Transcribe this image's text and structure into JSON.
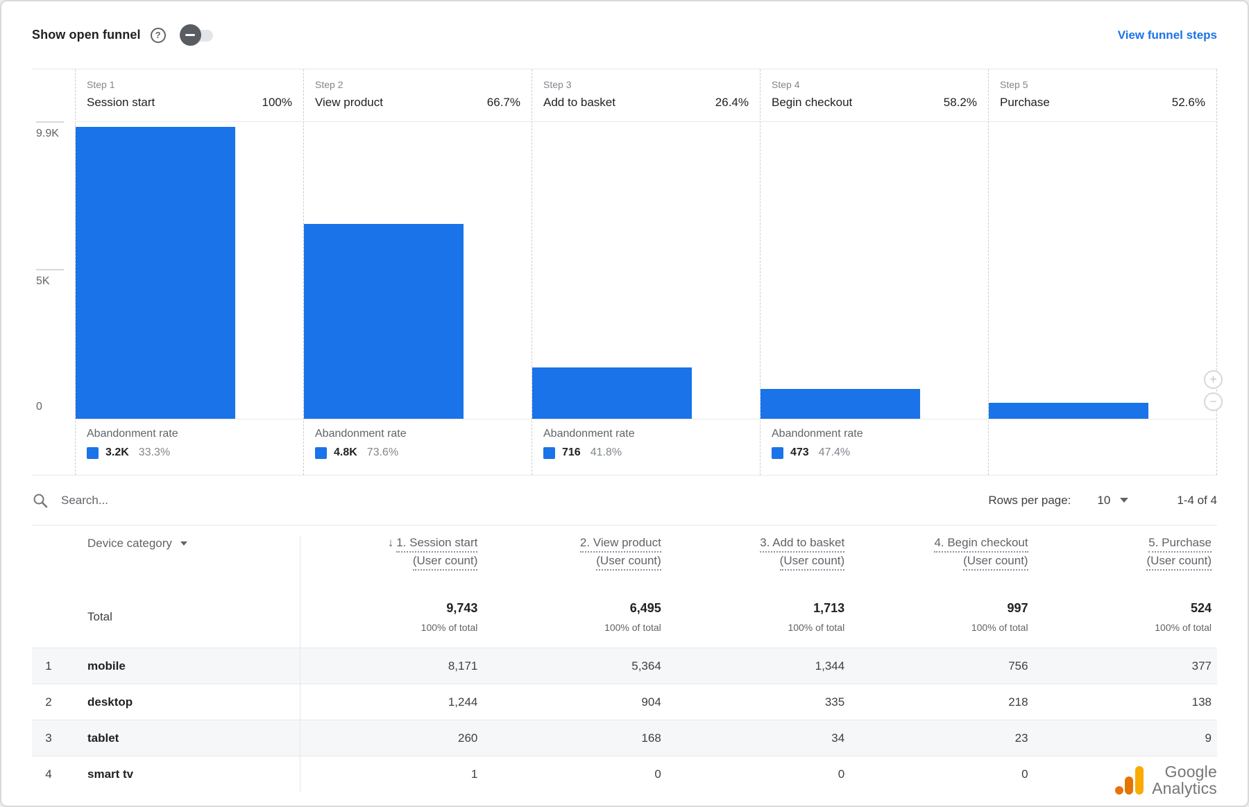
{
  "header": {
    "toggle_label": "Show open funnel",
    "link_label": "View funnel steps"
  },
  "icons": {
    "help": "circled-question-mark",
    "toggle_state": "indeterminate-off",
    "search": "magnifier",
    "rows_caret": "triangle-down",
    "device_caret": "triangle-down",
    "sort": "down-arrow",
    "zoom_in": "plus-circle",
    "zoom_out": "minus-circle"
  },
  "colors": {
    "accent_blue": "#1a73e8",
    "logo_amber": "#f9ab00",
    "logo_orange": "#e37400",
    "logo_deep_orange": "#e8710a"
  },
  "chart_data": {
    "type": "bar",
    "title": "Funnel steps (user count per step)",
    "ylim": [
      0,
      9900
    ],
    "y_axis_ticks": [
      "9.9K",
      "5K",
      "0"
    ],
    "grid": "horizontal ticks only",
    "bar_color": "#1a73e8",
    "abandonment_label": "Abandonment rate",
    "steps": [
      {
        "step_label": "Step 1",
        "name": "Session start",
        "percent": "100%",
        "value": 9743,
        "abandonment": {
          "count": "3.2K",
          "rate": "33.3%"
        }
      },
      {
        "step_label": "Step 2",
        "name": "View product",
        "percent": "66.7%",
        "value": 6495,
        "abandonment": {
          "count": "4.8K",
          "rate": "73.6%"
        }
      },
      {
        "step_label": "Step 3",
        "name": "Add to basket",
        "percent": "26.4%",
        "value": 1713,
        "abandonment": {
          "count": "716",
          "rate": "41.8%"
        }
      },
      {
        "step_label": "Step 4",
        "name": "Begin checkout",
        "percent": "58.2%",
        "value": 997,
        "abandonment": {
          "count": "473",
          "rate": "47.4%"
        }
      },
      {
        "step_label": "Step 5",
        "name": "Purchase",
        "percent": "52.6%",
        "value": 524,
        "abandonment": null
      }
    ]
  },
  "toolbar": {
    "search_placeholder": "Search...",
    "rows_per_page_label": "Rows per page:",
    "rows_per_page_value": "10",
    "range_label": "1-4 of 4"
  },
  "table": {
    "device_header": "Device category",
    "sort_arrow": "↓",
    "columns": [
      {
        "label": "1. Session start",
        "sub": "(User count)"
      },
      {
        "label": "2. View product",
        "sub": "(User count)"
      },
      {
        "label": "3. Add to basket",
        "sub": "(User count)"
      },
      {
        "label": "4. Begin checkout",
        "sub": "(User count)"
      },
      {
        "label": "5. Purchase",
        "sub": "(User count)"
      }
    ],
    "total_label": "Total",
    "total_sub": "100% of total",
    "totals": [
      "9,743",
      "6,495",
      "1,713",
      "997",
      "524"
    ],
    "rows": [
      {
        "index": "1",
        "device": "mobile",
        "values": [
          "8,171",
          "5,364",
          "1,344",
          "756",
          "377"
        ]
      },
      {
        "index": "2",
        "device": "desktop",
        "values": [
          "1,244",
          "904",
          "335",
          "218",
          "138"
        ]
      },
      {
        "index": "3",
        "device": "tablet",
        "values": [
          "260",
          "168",
          "34",
          "23",
          "9"
        ]
      },
      {
        "index": "4",
        "device": "smart tv",
        "values": [
          "1",
          "0",
          "0",
          "0",
          ""
        ]
      }
    ]
  },
  "branding": {
    "line1": "Google",
    "line2": "Analytics"
  }
}
